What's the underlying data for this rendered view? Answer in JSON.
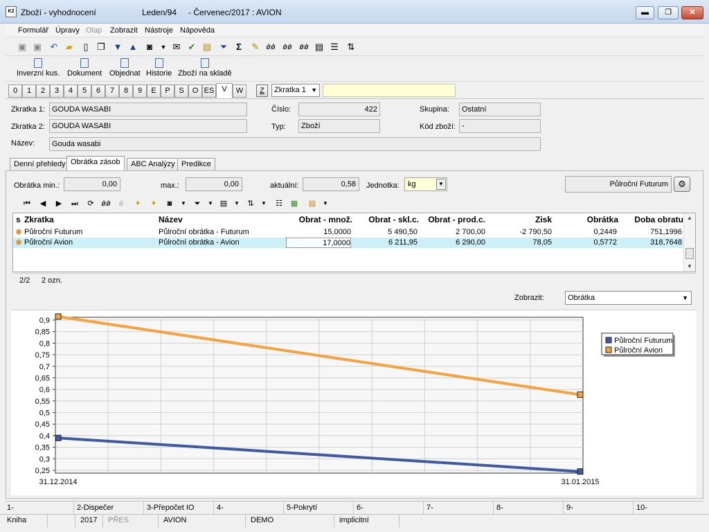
{
  "window": {
    "app_name": "Zboží - vyhodnocení",
    "period": "Leden/94",
    "range": "- Červenec/2017 : AVION",
    "minimize": "▬",
    "restore": "❐",
    "close": "✕"
  },
  "menu": [
    "Formulář",
    "Úpravy",
    "Olap",
    "Zobrazit",
    "Nástroje",
    "Nápověda"
  ],
  "toolbar_buttons": [
    "Inverzní kus.",
    "Dokument",
    "Objednat",
    "Historie",
    "Zboží na skladě"
  ],
  "letter_tabs": [
    "0",
    "1",
    "2",
    "3",
    "4",
    "5",
    "6",
    "7",
    "8",
    "9",
    "E",
    "P",
    "S",
    "O",
    "ES",
    "V",
    "W"
  ],
  "active_letter_tab": "V",
  "search": {
    "z_label": "Z",
    "field": "Zkratka 1"
  },
  "header": {
    "zkratka1_label": "Zkratka 1:",
    "zkratka1": "GOUDA WASABI",
    "zkratka2_label": "Zkratka 2:",
    "zkratka2": "GOUDA WASABI",
    "nazev_label": "Název:",
    "nazev": "Gouda wasabi",
    "cislo_label": "Číslo:",
    "cislo": "422",
    "typ_label": "Typ:",
    "typ": "Zboží",
    "skupina_label": "Skupina:",
    "skupina": "Ostatní",
    "kod_label": "Kód zboží:",
    "kod": "-"
  },
  "section_tabs": [
    "Denní přehledy",
    "Obrátka zásob",
    "ABC Analýzy",
    "Predikce"
  ],
  "active_section_tab": "Obrátka zásob",
  "filter": {
    "obratka_min_label": "Obrátka min.:",
    "obratka_min": "0,00",
    "max_label": "max.:",
    "max": "0,00",
    "aktualni_label": "aktuální:",
    "aktualni": "0,58",
    "jednotka_label": "Jednotka:",
    "jednotka": "kg",
    "profile": "Půlroční Futurum"
  },
  "grid": {
    "columns": [
      "s",
      "Zkratka",
      "Název",
      "Obrat - množ.",
      "Obrat - skl.c.",
      "Obrat - prod.c.",
      "Zisk",
      "Obrátka",
      "Doba obratu"
    ],
    "rows": [
      {
        "zkratka": "Půlroční Futurum",
        "nazev": "Půlroční obrátka - Futurum",
        "obrat_mnoz": "15,0000",
        "obrat_sklc": "5 490,50",
        "obrat_prodc": "2 700,00",
        "zisk": "-2 790,50",
        "obratka": "0,2449",
        "doba": "751,1996"
      },
      {
        "zkratka": "Půlroční Avion",
        "nazev": "Půlroční obrátka - Avion",
        "obrat_mnoz": "17,0000",
        "obrat_sklc": "6 211,95",
        "obrat_prodc": "6 290,00",
        "zisk": "78,05",
        "obratka": "0,5772",
        "doba": "318,7648"
      }
    ],
    "status_position": "2/2",
    "status_marked": "2 ozn."
  },
  "zobrazit": {
    "label": "Zobrazit:",
    "value": "Obrátka"
  },
  "chart_data": {
    "type": "line",
    "x": [
      "31.12.2014",
      "31.01.2015"
    ],
    "series": [
      {
        "name": "Půlroční Futurum",
        "values": [
          0.39,
          0.2449
        ],
        "color": "#3f5aa0"
      },
      {
        "name": "Půlroční Avion",
        "values": [
          0.915,
          0.5772
        ],
        "color": "#f5a340"
      }
    ],
    "ylim": [
      0.25,
      0.9
    ],
    "yticks": [
      "0,9",
      "0,85",
      "0,8",
      "0,75",
      "0,7",
      "0,65",
      "0,6",
      "0,55",
      "0,5",
      "0,45",
      "0,4",
      "0,35",
      "0,3",
      "0,25"
    ],
    "grid": true,
    "legend": "top-right"
  },
  "fkeys": [
    "1-",
    "2-Dispečer",
    "3-Přepočet IO",
    "4-",
    "5-Pokrytí",
    "6-",
    "7-",
    "8-",
    "9-",
    "10-"
  ],
  "statusbar": {
    "kniha": "Kniha",
    "year": "2017",
    "mode": "PŘES",
    "firm": "AVION",
    "db": "DEMO",
    "mode2": "implicitní"
  }
}
